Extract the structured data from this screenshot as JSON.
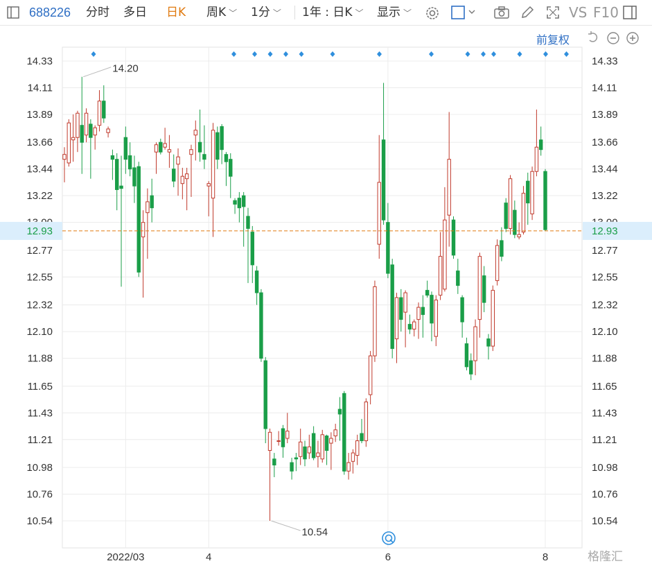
{
  "toolbar": {
    "code": "688226",
    "tabs": [
      "分时",
      "多日",
      "日K",
      "周K",
      "1分"
    ],
    "active_tab": "日K",
    "period": "1年 : 日K",
    "display": "显示",
    "vs": "VS",
    "f10": "F10"
  },
  "adjust_label": "前复权",
  "colors": {
    "up": "#c0392b",
    "down": "#1a9e48",
    "price_line": "#e07a10",
    "price_tag_bg": "#dbeefc",
    "price_tag_text": "#1a9e48",
    "marker": "#2f8fdd"
  },
  "watermark": "格隆汇",
  "chart_data": {
    "type": "candlestick",
    "y_ticks": [
      "14.33",
      "14.11",
      "13.89",
      "13.66",
      "13.44",
      "13.22",
      "13.00",
      "12.77",
      "12.55",
      "12.32",
      "12.10",
      "11.88",
      "11.65",
      "11.43",
      "11.21",
      "10.98",
      "10.76",
      "10.54"
    ],
    "ylim": [
      10.54,
      14.33
    ],
    "x_labels": [
      "2022/03",
      "4",
      "6",
      "8"
    ],
    "current_price": "12.93",
    "high_annotation": "14.20",
    "low_annotation": "10.54",
    "high_marker": "14.20",
    "low_marker": "10.54",
    "candles": [
      {
        "o": 13.52,
        "c": 13.56,
        "h": 13.62,
        "l": 13.33
      },
      {
        "o": 13.49,
        "c": 13.82,
        "h": 13.85,
        "l": 13.46
      },
      {
        "o": 13.68,
        "c": 13.7,
        "h": 13.89,
        "l": 13.5
      },
      {
        "o": 13.7,
        "c": 13.9,
        "h": 13.92,
        "l": 13.58
      },
      {
        "o": 13.8,
        "c": 13.66,
        "h": 14.2,
        "l": 13.4
      },
      {
        "o": 13.72,
        "c": 13.9,
        "h": 13.94,
        "l": 13.66
      },
      {
        "o": 13.81,
        "c": 13.7,
        "h": 13.85,
        "l": 13.36
      },
      {
        "o": 13.72,
        "c": 13.78,
        "h": 13.8,
        "l": 13.6
      },
      {
        "o": 13.8,
        "c": 14.0,
        "h": 14.09,
        "l": 13.75
      },
      {
        "o": 14.0,
        "c": 13.86,
        "h": 14.13,
        "l": 13.82
      },
      {
        "o": 13.74,
        "c": 13.77,
        "h": 13.79,
        "l": 13.7
      },
      {
        "o": 13.55,
        "c": 13.52,
        "h": 13.6,
        "l": 13.35
      },
      {
        "o": 13.52,
        "c": 13.27,
        "h": 13.57,
        "l": 13.1
      },
      {
        "o": 13.3,
        "c": 13.28,
        "h": 13.55,
        "l": 12.47
      },
      {
        "o": 13.7,
        "c": 13.52,
        "h": 13.79,
        "l": 13.4
      },
      {
        "o": 13.55,
        "c": 13.44,
        "h": 13.66,
        "l": 13.38
      },
      {
        "o": 13.45,
        "c": 13.3,
        "h": 13.55,
        "l": 13.16
      },
      {
        "o": 13.46,
        "c": 12.59,
        "h": 13.5,
        "l": 12.55
      },
      {
        "o": 12.88,
        "c": 13.0,
        "h": 13.1,
        "l": 12.38
      },
      {
        "o": 13.08,
        "c": 13.17,
        "h": 13.28,
        "l": 12.7
      },
      {
        "o": 13.22,
        "c": 13.12,
        "h": 13.36,
        "l": 13.0
      },
      {
        "o": 13.58,
        "c": 13.64,
        "h": 13.66,
        "l": 13.4
      },
      {
        "o": 13.66,
        "c": 13.58,
        "h": 13.69,
        "l": 13.56
      },
      {
        "o": 13.62,
        "c": 13.65,
        "h": 13.78,
        "l": 13.6
      },
      {
        "o": 13.58,
        "c": 13.6,
        "h": 13.72,
        "l": 13.45
      },
      {
        "o": 13.44,
        "c": 13.34,
        "h": 13.56,
        "l": 13.29
      },
      {
        "o": 13.48,
        "c": 13.54,
        "h": 13.61,
        "l": 13.22
      },
      {
        "o": 13.32,
        "c": 13.38,
        "h": 13.45,
        "l": 13.19
      },
      {
        "o": 13.36,
        "c": 13.4,
        "h": 13.45,
        "l": 13.1
      },
      {
        "o": 13.56,
        "c": 13.6,
        "h": 13.64,
        "l": 13.21
      },
      {
        "o": 13.72,
        "c": 13.76,
        "h": 13.84,
        "l": 13.51
      },
      {
        "o": 13.66,
        "c": 13.58,
        "h": 13.93,
        "l": 13.5
      },
      {
        "o": 13.56,
        "c": 13.52,
        "h": 13.8,
        "l": 13.44
      },
      {
        "o": 13.3,
        "c": 13.32,
        "h": 13.34,
        "l": 13.05
      },
      {
        "o": 13.2,
        "c": 13.76,
        "h": 13.82,
        "l": 12.88
      },
      {
        "o": 13.74,
        "c": 13.52,
        "h": 13.79,
        "l": 13.44
      },
      {
        "o": 13.79,
        "c": 13.6,
        "h": 13.81,
        "l": 13.48
      },
      {
        "o": 13.56,
        "c": 13.5,
        "h": 13.58,
        "l": 13.3
      },
      {
        "o": 13.52,
        "c": 13.38,
        "h": 13.57,
        "l": 13.2
      },
      {
        "o": 13.18,
        "c": 13.15,
        "h": 13.2,
        "l": 13.07
      },
      {
        "o": 13.2,
        "c": 13.12,
        "h": 13.25,
        "l": 13.0
      },
      {
        "o": 13.22,
        "c": 13.13,
        "h": 13.25,
        "l": 12.8
      },
      {
        "o": 13.05,
        "c": 12.95,
        "h": 13.12,
        "l": 12.5
      },
      {
        "o": 12.92,
        "c": 12.65,
        "h": 12.97,
        "l": 12.5
      },
      {
        "o": 12.6,
        "c": 12.42,
        "h": 12.64,
        "l": 12.32
      },
      {
        "o": 12.42,
        "c": 11.88,
        "h": 12.45,
        "l": 11.85
      },
      {
        "o": 11.86,
        "c": 11.3,
        "h": 11.89,
        "l": 11.18
      },
      {
        "o": 11.12,
        "c": 11.27,
        "h": 11.3,
        "l": 10.54
      },
      {
        "o": 11.05,
        "c": 11.0,
        "h": 11.1,
        "l": 10.9
      },
      {
        "o": 11.2,
        "c": 11.2,
        "h": 11.28,
        "l": 11.16
      },
      {
        "o": 11.3,
        "c": 11.15,
        "h": 11.33,
        "l": 11.06
      },
      {
        "o": 11.22,
        "c": 11.28,
        "h": 11.43,
        "l": 11.18
      },
      {
        "o": 11.02,
        "c": 10.95,
        "h": 11.06,
        "l": 10.88
      },
      {
        "o": 11.06,
        "c": 11.05,
        "h": 11.1,
        "l": 10.95
      },
      {
        "o": 11.07,
        "c": 11.19,
        "h": 11.3,
        "l": 11.0
      },
      {
        "o": 11.15,
        "c": 11.05,
        "h": 11.2,
        "l": 10.99
      },
      {
        "o": 11.1,
        "c": 11.15,
        "h": 11.25,
        "l": 11.05
      },
      {
        "o": 11.26,
        "c": 11.06,
        "h": 11.32,
        "l": 11.04
      },
      {
        "o": 11.07,
        "c": 11.1,
        "h": 11.2,
        "l": 10.98
      },
      {
        "o": 11.05,
        "c": 11.25,
        "h": 11.29,
        "l": 11.02
      },
      {
        "o": 11.24,
        "c": 11.12,
        "h": 11.25,
        "l": 11.0
      },
      {
        "o": 11.18,
        "c": 11.22,
        "h": 11.27,
        "l": 10.96
      },
      {
        "o": 11.24,
        "c": 11.29,
        "h": 11.34,
        "l": 11.19
      },
      {
        "o": 11.46,
        "c": 11.42,
        "h": 11.56,
        "l": 11.2
      },
      {
        "o": 11.59,
        "c": 10.95,
        "h": 11.61,
        "l": 10.92
      },
      {
        "o": 10.95,
        "c": 11.02,
        "h": 11.1,
        "l": 10.88
      },
      {
        "o": 11.03,
        "c": 11.1,
        "h": 11.13,
        "l": 10.93
      },
      {
        "o": 11.08,
        "c": 11.2,
        "h": 11.25,
        "l": 11.0
      },
      {
        "o": 11.26,
        "c": 11.2,
        "h": 11.38,
        "l": 11.18
      },
      {
        "o": 11.2,
        "c": 11.52,
        "h": 11.55,
        "l": 11.15
      },
      {
        "o": 11.58,
        "c": 11.9,
        "h": 11.94,
        "l": 11.5
      },
      {
        "o": 11.9,
        "c": 12.47,
        "h": 12.52,
        "l": 11.85
      },
      {
        "o": 12.82,
        "c": 13.33,
        "h": 13.72,
        "l": 12.7
      },
      {
        "o": 13.68,
        "c": 13.02,
        "h": 14.15,
        "l": 12.98
      },
      {
        "o": 13.0,
        "c": 12.58,
        "h": 13.16,
        "l": 12.54
      },
      {
        "o": 12.65,
        "c": 11.96,
        "h": 12.7,
        "l": 11.88
      },
      {
        "o": 12.04,
        "c": 12.38,
        "h": 12.42,
        "l": 11.84
      },
      {
        "o": 12.38,
        "c": 12.2,
        "h": 12.45,
        "l": 12.1
      },
      {
        "o": 12.26,
        "c": 12.42,
        "h": 12.44,
        "l": 11.97
      },
      {
        "o": 12.16,
        "c": 12.12,
        "h": 12.24,
        "l": 12.08
      },
      {
        "o": 12.12,
        "c": 12.18,
        "h": 12.2,
        "l": 12.06
      },
      {
        "o": 12.2,
        "c": 12.3,
        "h": 12.34,
        "l": 12.04
      },
      {
        "o": 12.3,
        "c": 12.24,
        "h": 12.4,
        "l": 12.05
      },
      {
        "o": 12.44,
        "c": 12.4,
        "h": 12.52,
        "l": 12.38
      },
      {
        "o": 12.4,
        "c": 12.17,
        "h": 12.43,
        "l": 12.02
      },
      {
        "o": 12.06,
        "c": 12.36,
        "h": 12.4,
        "l": 11.98
      },
      {
        "o": 12.4,
        "c": 12.72,
        "h": 12.92,
        "l": 12.36
      },
      {
        "o": 12.45,
        "c": 13.02,
        "h": 13.29,
        "l": 12.43
      },
      {
        "o": 13.06,
        "c": 13.52,
        "h": 13.91,
        "l": 12.8
      },
      {
        "o": 13.02,
        "c": 12.73,
        "h": 13.05,
        "l": 12.7
      },
      {
        "o": 12.6,
        "c": 12.48,
        "h": 12.7,
        "l": 12.41
      },
      {
        "o": 12.38,
        "c": 12.18,
        "h": 12.4,
        "l": 12.05
      },
      {
        "o": 12.0,
        "c": 11.81,
        "h": 12.05,
        "l": 11.78
      },
      {
        "o": 11.86,
        "c": 11.75,
        "h": 11.92,
        "l": 11.7
      },
      {
        "o": 11.86,
        "c": 12.14,
        "h": 12.2,
        "l": 11.74
      },
      {
        "o": 12.2,
        "c": 12.72,
        "h": 12.75,
        "l": 12.05
      },
      {
        "o": 12.56,
        "c": 12.34,
        "h": 12.64,
        "l": 12.26
      },
      {
        "o": 12.04,
        "c": 11.98,
        "h": 12.08,
        "l": 11.87
      },
      {
        "o": 11.98,
        "c": 12.44,
        "h": 12.48,
        "l": 11.94
      },
      {
        "o": 12.52,
        "c": 12.81,
        "h": 12.86,
        "l": 12.48
      },
      {
        "o": 12.85,
        "c": 12.72,
        "h": 12.96,
        "l": 12.68
      },
      {
        "o": 13.16,
        "c": 12.95,
        "h": 13.2,
        "l": 12.92
      },
      {
        "o": 12.95,
        "c": 13.36,
        "h": 13.39,
        "l": 12.9
      },
      {
        "o": 13.1,
        "c": 12.9,
        "h": 13.18,
        "l": 12.87
      },
      {
        "o": 12.88,
        "c": 12.9,
        "h": 13.0,
        "l": 12.86
      },
      {
        "o": 12.92,
        "c": 13.24,
        "h": 13.3,
        "l": 12.9
      },
      {
        "o": 13.34,
        "c": 13.16,
        "h": 13.41,
        "l": 12.98
      },
      {
        "o": 13.07,
        "c": 13.42,
        "h": 13.46,
        "l": 13.02
      },
      {
        "o": 13.42,
        "c": 13.62,
        "h": 13.93,
        "l": 13.38
      },
      {
        "o": 13.68,
        "c": 13.6,
        "h": 13.79,
        "l": 13.55
      },
      {
        "o": 13.42,
        "c": 12.94,
        "h": 13.44,
        "l": 12.93
      }
    ],
    "markers": [
      0.06,
      0.33,
      0.37,
      0.4,
      0.43,
      0.46,
      0.52,
      0.61,
      0.71,
      0.78,
      0.81,
      0.83,
      0.88,
      0.93,
      0.97
    ]
  }
}
